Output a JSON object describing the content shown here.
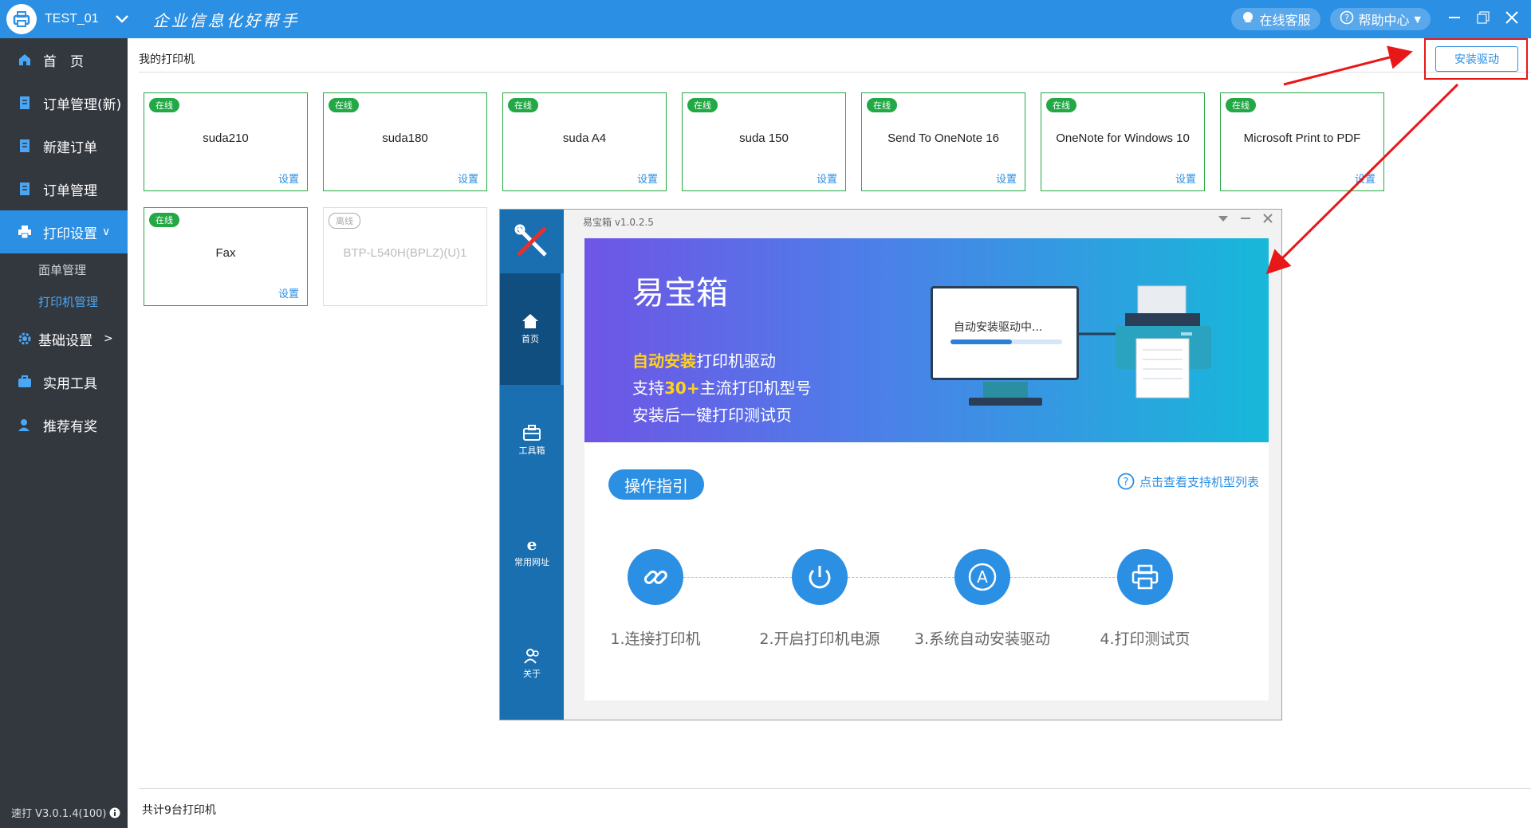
{
  "titlebar": {
    "user": "TEST_01",
    "slogan": "企业信息化好帮手",
    "service_label": "在线客服",
    "help_label": "帮助中心",
    "help_caret": "▼"
  },
  "sidebar": {
    "items": [
      {
        "label": "首　页",
        "icon": "home-icon"
      },
      {
        "label": "订单管理(新)",
        "icon": "document-icon"
      },
      {
        "label": "新建订单",
        "icon": "document-icon"
      },
      {
        "label": "订单管理",
        "icon": "document-icon"
      },
      {
        "label": "打印设置",
        "icon": "printer-icon",
        "suffix": "∨"
      },
      {
        "label": "基础设置",
        "icon": "gear-icon",
        "suffix": ">"
      },
      {
        "label": "实用工具",
        "icon": "toolbox-icon"
      },
      {
        "label": "推荐有奖",
        "icon": "user-gift-icon"
      }
    ],
    "subitems": [
      "面单管理",
      "打印机管理"
    ],
    "version": "速打 V3.0.1.4(100)"
  },
  "main": {
    "page_title": "我的打印机",
    "install_button": "安装驱动",
    "printers": [
      {
        "status": "在线",
        "name": "suda210",
        "settings": "设置"
      },
      {
        "status": "在线",
        "name": "suda180",
        "settings": "设置"
      },
      {
        "status": "在线",
        "name": "suda A4",
        "settings": "设置"
      },
      {
        "status": "在线",
        "name": "suda 150",
        "settings": "设置"
      },
      {
        "status": "在线",
        "name": "Send To OneNote 16",
        "settings": "设置"
      },
      {
        "status": "在线",
        "name": "OneNote for Windows 10",
        "settings": "设置"
      },
      {
        "status": "在线",
        "name": "Microsoft Print to PDF",
        "settings": "设置"
      },
      {
        "status": "在线",
        "name": "Fax",
        "settings": "设置"
      },
      {
        "status": "离线",
        "name": "BTP-L540H(BPLZ)(U)1",
        "settings": ""
      }
    ],
    "total": "共计9台打印机"
  },
  "popup": {
    "title": "易宝箱 v1.0.2.5",
    "nav": [
      "首页",
      "工具箱",
      "常用网址",
      "关于"
    ],
    "banner": {
      "heading": "易宝箱",
      "line1_hl": "自动安装",
      "line1_rest": "打印机驱动",
      "line2_pre": "支持",
      "line2_hl": "30+",
      "line2_rest": "主流打印机型号",
      "line3": "安装后一键打印测试页",
      "monitor_text": "自动安装驱动中...",
      "progress": 0.55
    },
    "guide_button": "操作指引",
    "support_link": "点击查看支持机型列表",
    "steps": [
      "1.连接打印机",
      "2.开启打印机电源",
      "3.系统自动安装驱动",
      "4.打印测试页"
    ]
  },
  "colors": {
    "accent": "#2b8fe3",
    "online": "#22a845",
    "sidebar": "#33373e",
    "annotation": "#e81818"
  }
}
